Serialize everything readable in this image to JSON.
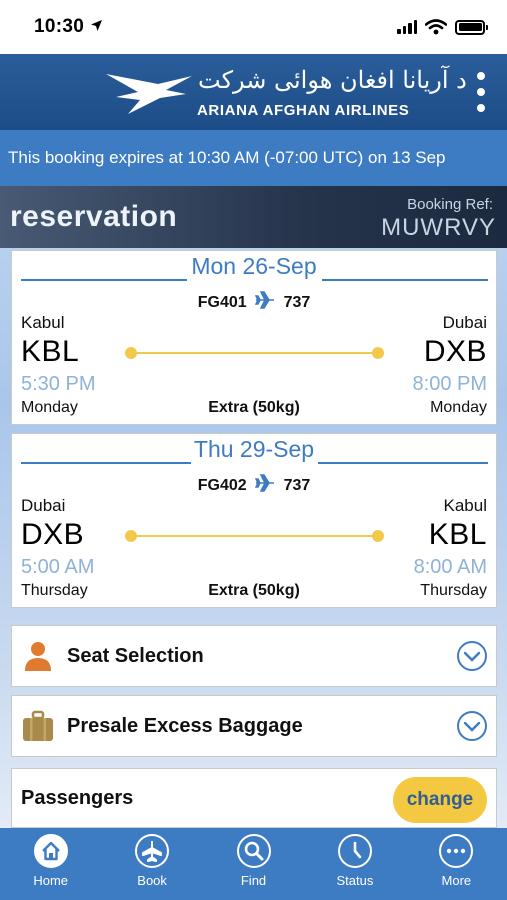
{
  "status_bar": {
    "time": "10:30"
  },
  "header": {
    "logo_arabic": "د آریانا افغان هوائی شرکت",
    "logo_english": "ARIANA AFGHAN AIRLINES"
  },
  "banner": {
    "text": "This booking expires at 10:30 AM (-07:00 UTC) on 13 Sep"
  },
  "reservation": {
    "title": "reservation",
    "ref_label": "Booking Ref:",
    "ref_value": "MUWRVY"
  },
  "flights": [
    {
      "date": "Mon 26-Sep",
      "flight_no": "FG401",
      "aircraft": "737",
      "from_city": "Kabul",
      "from_code": "KBL",
      "from_time": "5:30 PM",
      "from_day": "Monday",
      "to_city": "Dubai",
      "to_code": "DXB",
      "to_time": "8:00 PM",
      "to_day": "Monday",
      "baggage": "Extra (50kg)"
    },
    {
      "date": "Thu 29-Sep",
      "flight_no": "FG402",
      "aircraft": "737",
      "from_city": "Dubai",
      "from_code": "DXB",
      "from_time": "5:00 AM",
      "from_day": "Thursday",
      "to_city": "Kabul",
      "to_code": "KBL",
      "to_time": "8:00 AM",
      "to_day": "Thursday",
      "baggage": "Extra (50kg)"
    }
  ],
  "sections": [
    {
      "label": "Seat Selection",
      "icon": "person-icon",
      "color": "#e07a2e"
    },
    {
      "label": "Presale Excess Baggage",
      "icon": "suitcase-icon",
      "color": "#a88a4a"
    }
  ],
  "passengers": {
    "label": "Passengers",
    "change_label": "change"
  },
  "tabs": [
    {
      "label": "Home",
      "icon": "home-icon",
      "active": true
    },
    {
      "label": "Book",
      "icon": "plane-icon",
      "active": false
    },
    {
      "label": "Find",
      "icon": "search-icon",
      "active": false
    },
    {
      "label": "Status",
      "icon": "clock-icon",
      "active": false
    },
    {
      "label": "More",
      "icon": "more-icon",
      "active": false
    }
  ],
  "colors": {
    "brand_blue": "#3d7cc3",
    "header_blue": "#1d4d88",
    "accent_yellow": "#f5c842",
    "route_yellow": "#f2c94c",
    "time_blue": "#8fb2d8"
  }
}
